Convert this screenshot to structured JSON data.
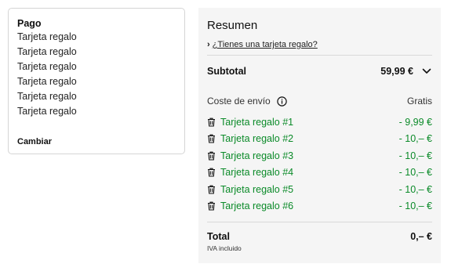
{
  "payment": {
    "title": "Pago",
    "methods": [
      "Tarjeta regalo",
      "Tarjeta regalo",
      "Tarjeta regalo",
      "Tarjeta regalo",
      "Tarjeta regalo",
      "Tarjeta regalo"
    ],
    "change_label": "Cambiar"
  },
  "summary": {
    "title": "Resumen",
    "gift_card_link": "¿Tienes una tarjeta regalo?",
    "subtotal_label": "Subtotal",
    "subtotal_value": "59,99 €",
    "shipping_label": "Coste de envío",
    "shipping_value": "Gratis",
    "gift_cards": [
      {
        "label": "Tarjeta regalo #1",
        "amount": "- 9,99 €"
      },
      {
        "label": "Tarjeta regalo #2",
        "amount": "- 10,– €"
      },
      {
        "label": "Tarjeta regalo #3",
        "amount": "- 10,– €"
      },
      {
        "label": "Tarjeta regalo #4",
        "amount": "- 10,– €"
      },
      {
        "label": "Tarjeta regalo #5",
        "amount": "- 10,– €"
      },
      {
        "label": "Tarjeta regalo #6",
        "amount": "- 10,– €"
      }
    ],
    "total_label": "Total",
    "total_value": "0,– €",
    "vat_note": "IVA incluido"
  },
  "icons": {
    "link_chevron": "chevron-right-icon",
    "subtotal_toggle": "chevron-down-icon",
    "shipping_info": "info-icon",
    "remove_gift": "trash-icon"
  },
  "colors": {
    "discount_green": "#0a8a28",
    "summary_bg": "#f5f5f5"
  }
}
